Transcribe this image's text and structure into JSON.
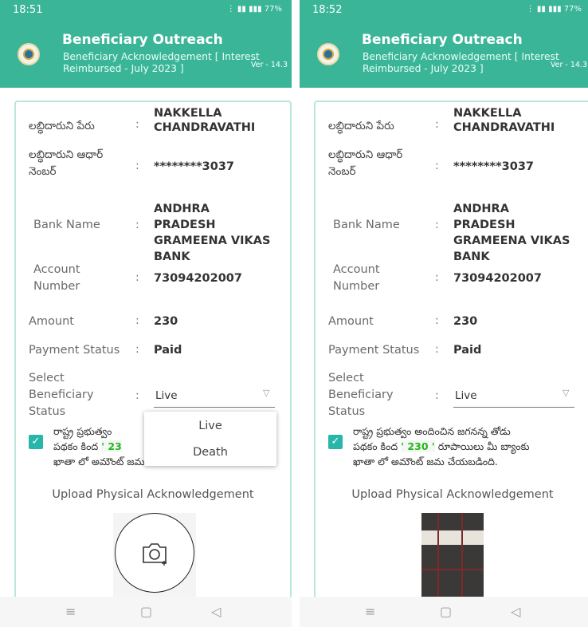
{
  "screens": [
    {
      "status_time": "18:51",
      "status_icons": "77%",
      "app_title": "Beneficiary Outreach",
      "app_subtitle": "Beneficiary Acknowledgement [ Interest Reimbursed - July 2023 ]",
      "version": "Ver - 14.3",
      "fields": {
        "name_label": "లబ్ధిదారుని పేరు",
        "name_value": "NAKKELLA CHANDRAVATHI",
        "aadhaar_label": "లబ్ధిదారుని ఆధార్ నెంబర్",
        "aadhaar_value": "********3037",
        "bank_label": "Bank Name",
        "bank_value": "ANDHRA PRADESH GRAMEENA VIKAS BANK",
        "account_label": "Account Number",
        "account_value": "73094202007",
        "amount_label": "Amount",
        "amount_value": "230",
        "payment_label": "Payment Status",
        "payment_value": "Paid",
        "status_label": "Select Beneficiary Status",
        "status_selected": "Live"
      },
      "consent_pre": "రాష్ట్ర ప్రభుత్వం",
      "consent_amount": "23",
      "consent_line2_pre": "పథకం కింద",
      "consent_line3": "ఖాతా లో అమౌంట్ జమ చేయబడింది.",
      "consent_checked": true,
      "upload_title": "Upload Physical Acknowledgement",
      "dropdown_options": [
        "Live",
        "Death"
      ]
    },
    {
      "status_time": "18:52",
      "status_icons": "77%",
      "app_title": "Beneficiary Outreach",
      "app_subtitle": "Beneficiary Acknowledgement [ Interest Reimbursed - July 2023 ]",
      "version": "Ver - 14.3",
      "fields": {
        "name_label": "లబ్ధిదారుని పేరు",
        "name_value": "NAKKELLA CHANDRAVATHI",
        "aadhaar_label": "లబ్ధిదారుని ఆధార్ నెంబర్",
        "aadhaar_value": "********3037",
        "bank_label": "Bank Name",
        "bank_value": "ANDHRA PRADESH GRAMEENA VIKAS BANK",
        "account_label": "Account Number",
        "account_value": "73094202007",
        "amount_label": "Amount",
        "amount_value": "230",
        "payment_label": "Payment Status",
        "payment_value": "Paid",
        "status_label": "Select Beneficiary Status",
        "status_selected": "Live"
      },
      "consent_line1": "రాష్ట్ర ప్రభుత్వం అందించిన జగనన్న తోడు",
      "consent_line2_pre": "పథకం కింద",
      "consent_amount": "230",
      "consent_line2_post": "రూపాయిలు మీ బ్యాంకు",
      "consent_line3": "ఖాతా లో అమౌంట్ జమ చేయబడింది.",
      "consent_checked": true,
      "upload_title": "Upload Physical Acknowledgement"
    }
  ],
  "nav": {
    "menu_icon": "≡",
    "home_icon": "▢",
    "back_icon": "◁"
  },
  "colors": {
    "header": "#3bb598",
    "checkbox": "#27b6a8",
    "amount_highlight": "#27b51f"
  }
}
